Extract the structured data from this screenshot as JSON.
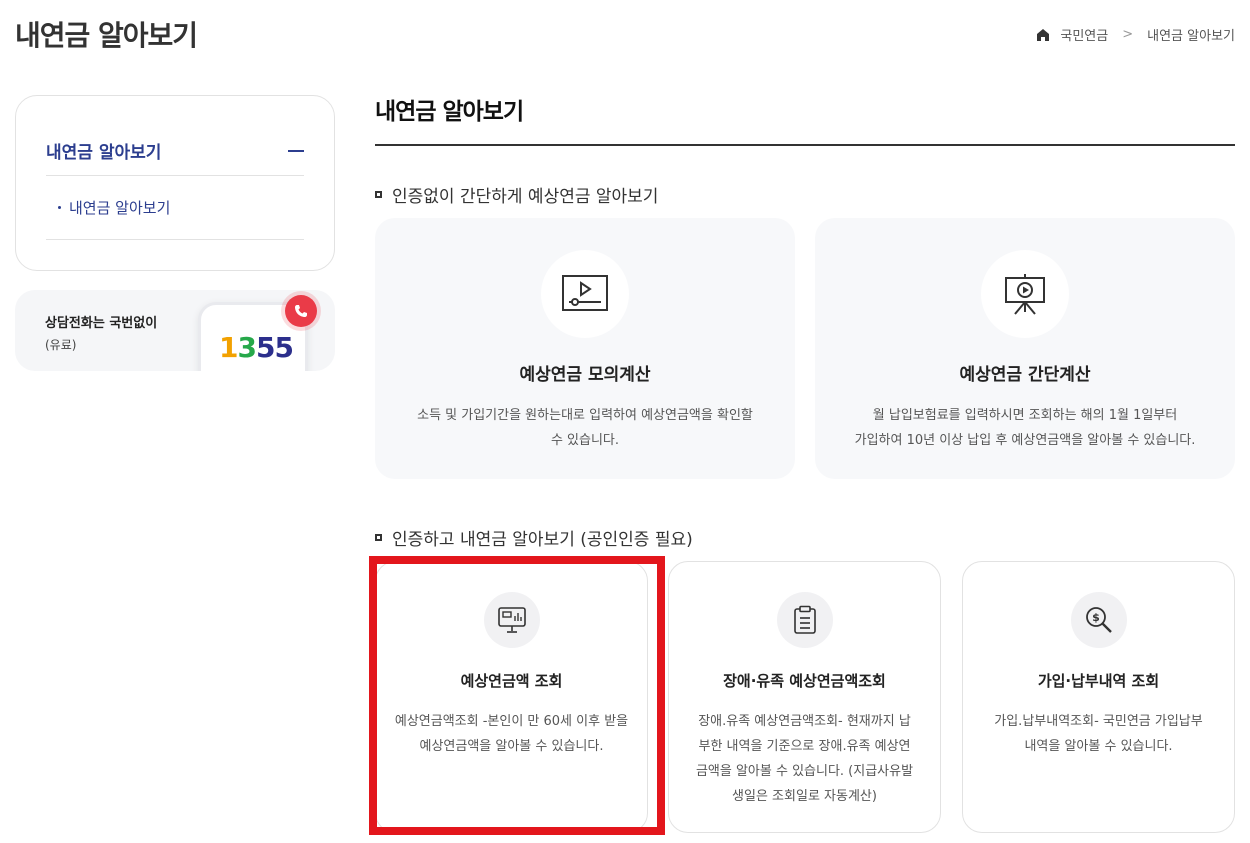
{
  "header": {
    "page_title": "내연금 알아보기",
    "breadcrumb": {
      "home_icon": "home-icon",
      "level1": "국민연금",
      "separator": ">",
      "level2": "내연금 알아보기"
    }
  },
  "sidebar": {
    "menu_title": "내연금 알아보기",
    "collapse_icon": "minus-icon",
    "sub_items": [
      {
        "label": "내연금 알아보기"
      }
    ],
    "call_box": {
      "title": "상담전화는 국번없이",
      "sub": "(유료)",
      "number": {
        "d1": "1",
        "d2": "3",
        "d3": "55"
      },
      "icon": "phone-icon"
    }
  },
  "main": {
    "title": "내연금 알아보기",
    "section1": {
      "heading": "인증없이 간단하게 예상연금 알아보기",
      "cards": [
        {
          "icon": "video-player-icon",
          "title": "예상연금 모의계산",
          "desc": "소득 및 가입기간을 원하는대로 입력하여 예상연금액을 확인할 수 있습니다."
        },
        {
          "icon": "presentation-board-icon",
          "title": "예상연금 간단계산",
          "desc_line1": "월 납입보험료를 입력하시면 조회하는 해의 1월 1일부터",
          "desc_line2": "가입하여 10년 이상 납입 후 예상연금액을 알아볼 수 있습니다."
        }
      ]
    },
    "section2": {
      "heading": "인증하고 내연금 알아보기 (공인인증 필요)",
      "cards": [
        {
          "icon": "monitor-chart-icon",
          "title": "예상연금액 조회",
          "desc": "예상연금액조회 -본인이 만 60세 이후 받을 예상연금액을 알아볼 수 있습니다."
        },
        {
          "icon": "clipboard-icon",
          "title": "장애·유족 예상연금액조회",
          "desc": "장애.유족 예상연금액조회- 현재까지 납부한 내역을 기준으로 장애.유족 예상연금액을 알아볼 수 있습니다. (지급사유발생일은 조회일로 자동계산)"
        },
        {
          "icon": "dollar-search-icon",
          "title": "가입·납부내역 조회",
          "desc": "가입.납부내역조회- 국민연금 가입납부내역을 알아볼 수 있습니다."
        }
      ]
    }
  },
  "colors": {
    "accent": "#2c3e8f",
    "highlight": "#e3161c",
    "card_bg": "#f7f8fa"
  }
}
